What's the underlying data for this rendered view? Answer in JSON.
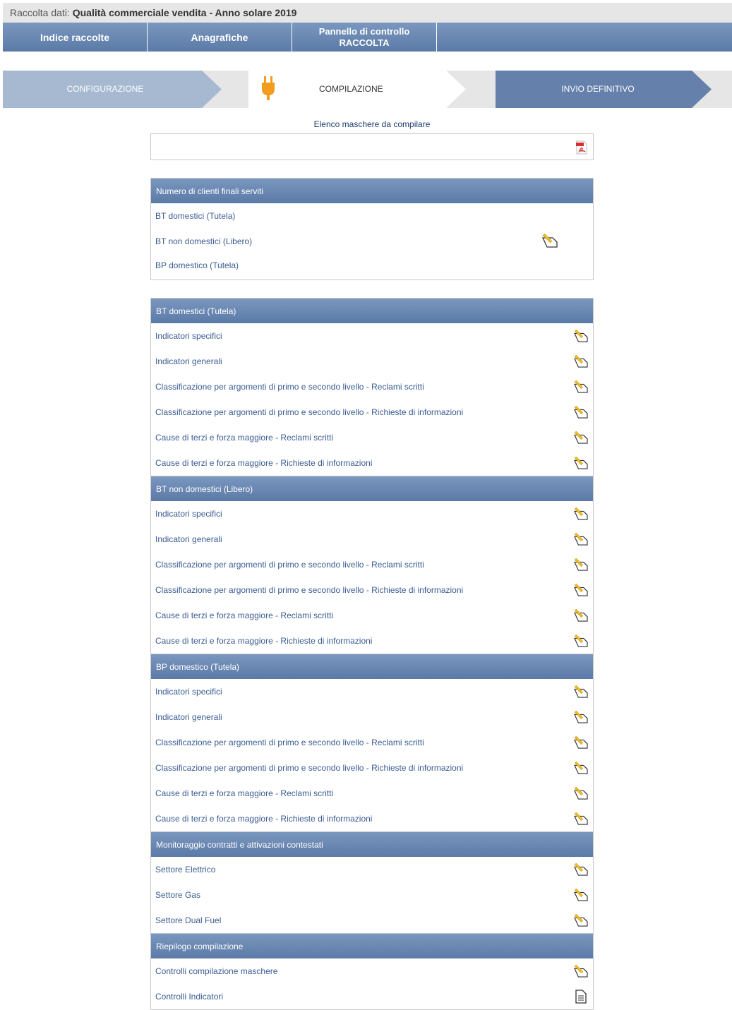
{
  "header": {
    "prefix": "Raccolta dati:",
    "title": "Qualità commerciale vendita - Anno solare 2019"
  },
  "nav": {
    "items": [
      {
        "label": "Indice raccolte"
      },
      {
        "label": "Anagrafiche"
      },
      {
        "line1": "Pannello di controllo",
        "line2": "RACCOLTA"
      }
    ]
  },
  "steps": {
    "configurazione": "CONFIGURAZIONE",
    "compilazione": "COMPILAZIONE",
    "invio": "INVIO DEFINITIVO"
  },
  "elenco": {
    "title": "Elenco maschere da compilare"
  },
  "numero_clienti": {
    "header": "Numero di clienti finali serviti",
    "items": [
      "BT domestici (Tutela)",
      "BT non domestici (Libero)",
      "BP domestico (Tutela)"
    ]
  },
  "sections": [
    {
      "header": "BT domestici (Tutela)",
      "items": [
        "Indicatori specifici",
        "Indicatori generali",
        "Classificazione per argomenti di primo e secondo livello - Reclami scritti",
        "Classificazione per argomenti di primo e secondo livello - Richieste di informazioni",
        "Cause di terzi e forza maggiore - Reclami scritti",
        "Cause di terzi e forza maggiore - Richieste di informazioni"
      ]
    },
    {
      "header": "BT non domestici (Libero)",
      "items": [
        "Indicatori specifici",
        "Indicatori generali",
        "Classificazione per argomenti di primo e secondo livello - Reclami scritti",
        "Classificazione per argomenti di primo e secondo livello - Richieste di informazioni",
        "Cause di terzi e forza maggiore - Reclami scritti",
        "Cause di terzi e forza maggiore - Richieste di informazioni"
      ]
    },
    {
      "header": "BP domestico (Tutela)",
      "items": [
        "Indicatori specifici",
        "Indicatori generali",
        "Classificazione per argomenti di primo e secondo livello - Reclami scritti",
        "Classificazione per argomenti di primo e secondo livello - Richieste di informazioni",
        "Cause di terzi e forza maggiore - Reclami scritti",
        "Cause di terzi e forza maggiore - Richieste di informazioni"
      ]
    },
    {
      "header": "Monitoraggio contratti e attivazioni contestati",
      "items": [
        "Settore Elettrico",
        "Settore Gas",
        "Settore Dual Fuel"
      ]
    },
    {
      "header": "Riepilogo compilazione",
      "items": [
        "Controlli compilazione maschere",
        "Controlli Indicatori"
      ]
    }
  ]
}
